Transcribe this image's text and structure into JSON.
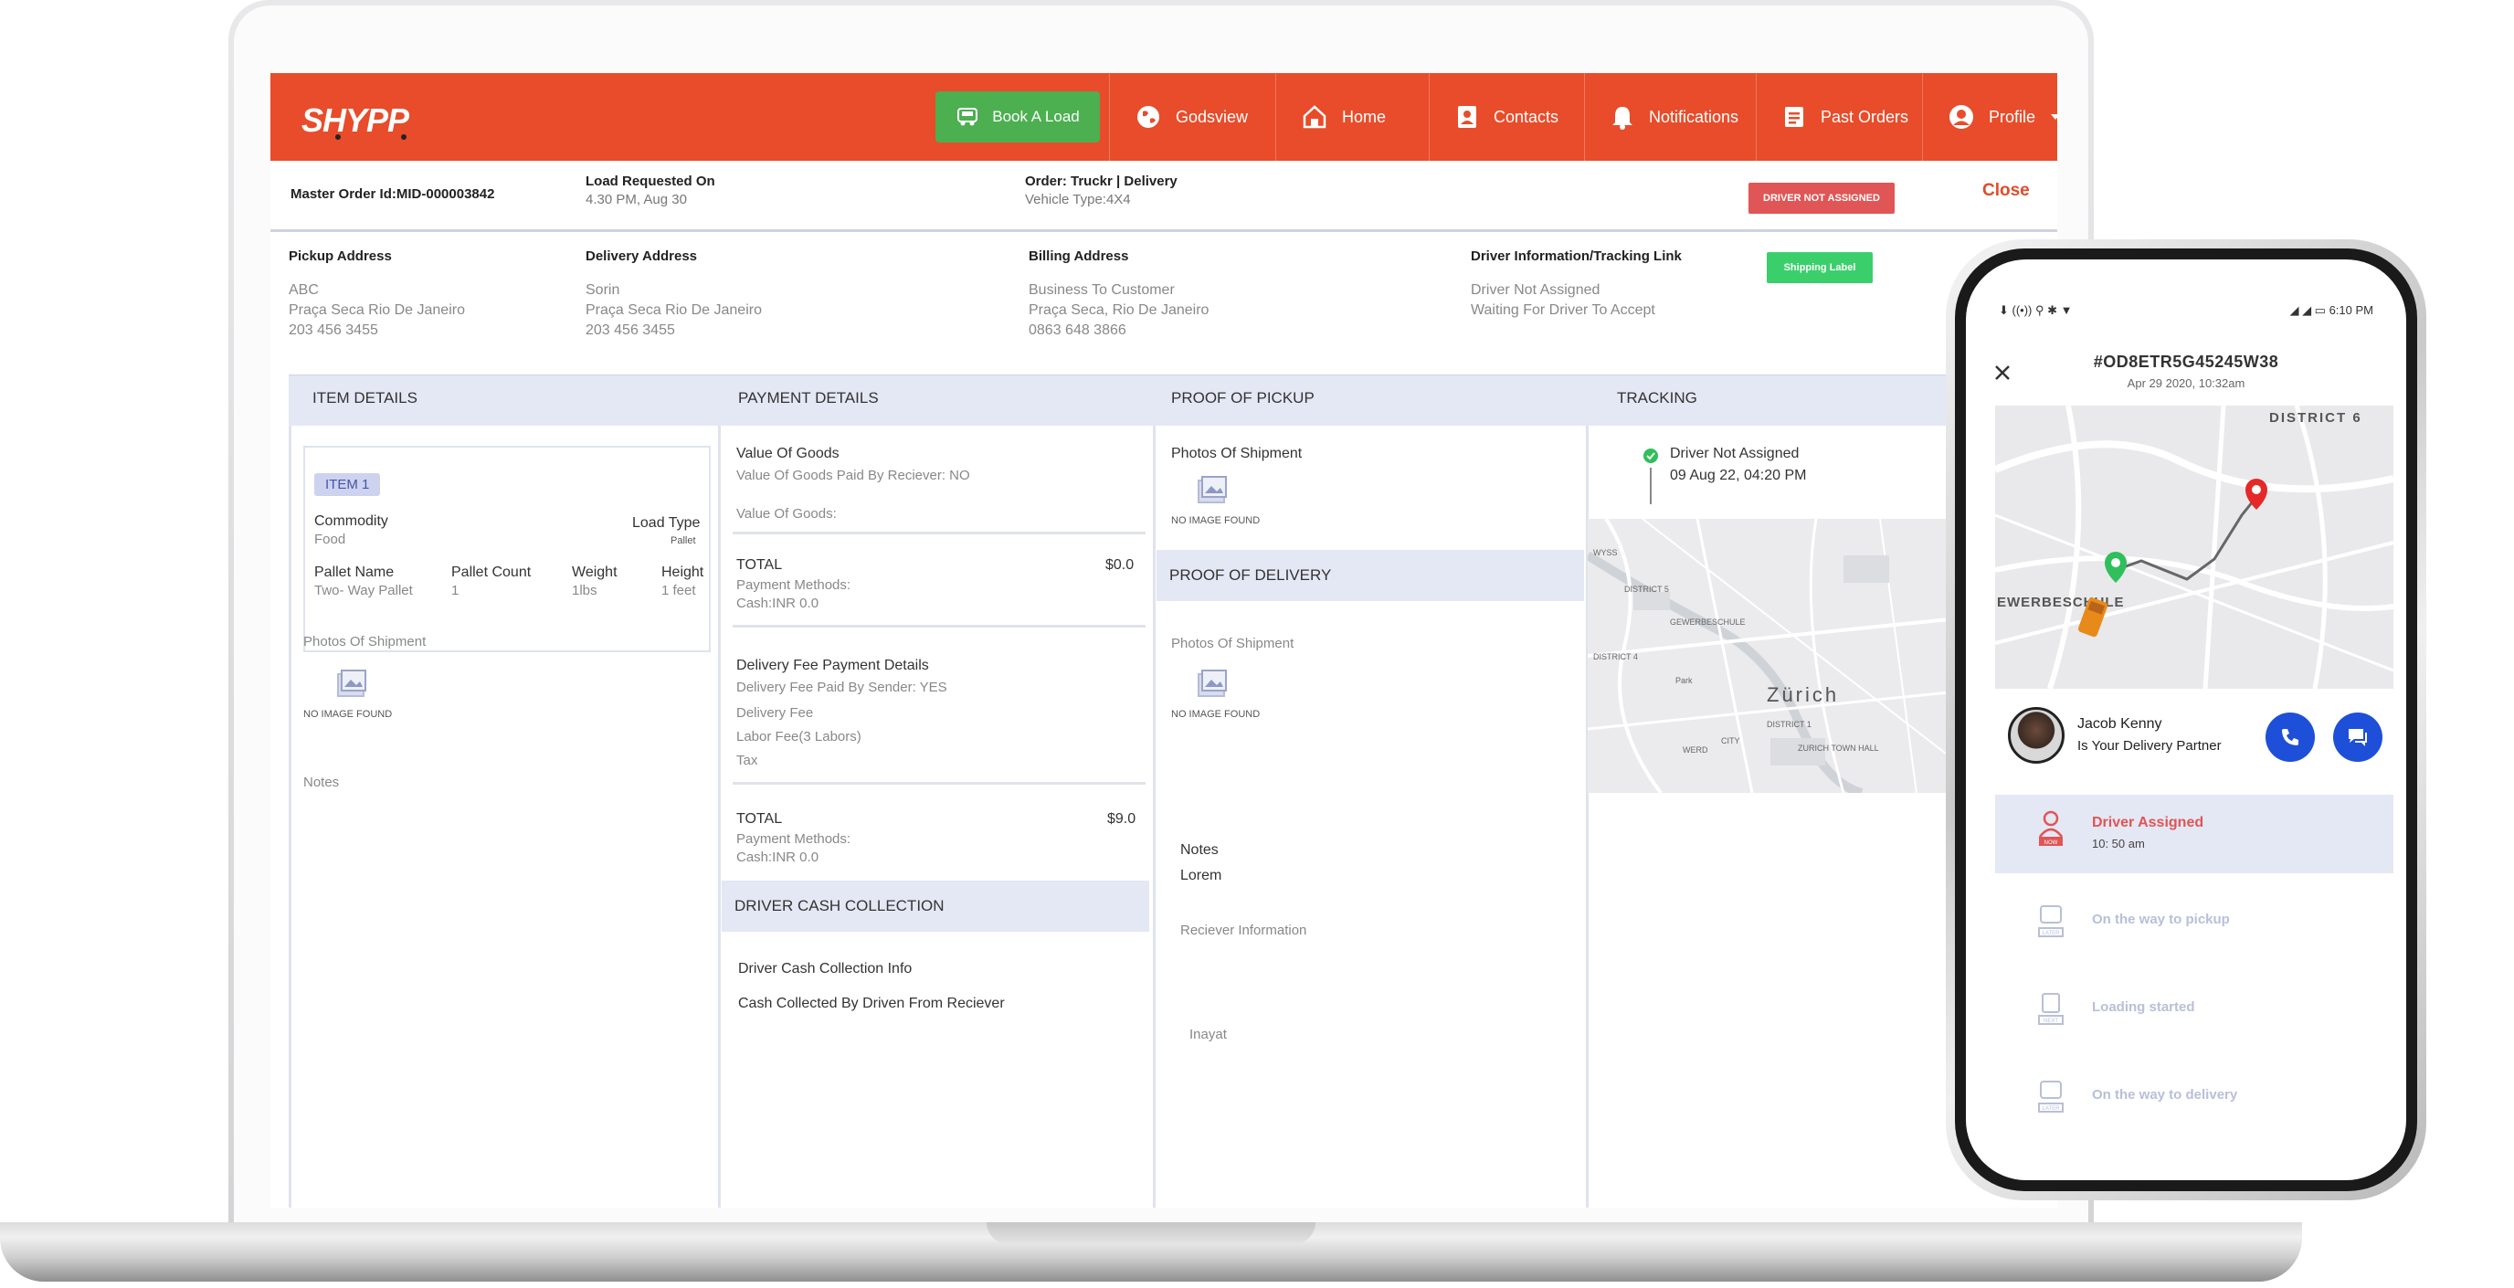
{
  "nav": {
    "logo": "SHYPP",
    "book_label": "Book A Load",
    "items": [
      {
        "label": "Godsview",
        "icon": "globe-icon"
      },
      {
        "label": "Home",
        "icon": "home-icon"
      },
      {
        "label": "Contacts",
        "icon": "contacts-icon"
      },
      {
        "label": "Notifications",
        "icon": "bell-icon"
      },
      {
        "label": "Past Orders",
        "icon": "orders-icon"
      },
      {
        "label": "Profile",
        "icon": "profile-icon"
      }
    ]
  },
  "order": {
    "master_id": "Master Order Id:MID-000003842",
    "load_requested_label": "Load Requested On",
    "load_requested_value": "4.30 PM, Aug 30",
    "order_label": "Order: Truckr | Delivery",
    "vehicle_type": "Vehicle Type:4X4",
    "status_badge": "DRIVER NOT ASSIGNED",
    "close_label": "Close"
  },
  "addresses": {
    "pickup": {
      "heading": "Pickup Address",
      "lines": [
        "ABC",
        "Praça Seca Rio De Janeiro",
        " 203 456 3455"
      ]
    },
    "delivery": {
      "heading": "Delivery Address",
      "lines": [
        "Sorin",
        "Praça Seca Rio De Janeiro",
        " 203 456 3455"
      ]
    },
    "billing": {
      "heading": "Billing Address",
      "lines": [
        "Business To Customer",
        "Praça Seca, Rio De Janeiro",
        "0863 648 3866"
      ]
    },
    "driver": {
      "heading": "Driver Information/Tracking Link",
      "lines": [
        "Driver Not Assigned",
        "Waiting For Driver To Accept"
      ]
    },
    "shipping_label": "Shipping Label"
  },
  "sections": {
    "item_details": "ITEM  DETAILS",
    "payment_details": "PAYMENT DETAILS",
    "proof_of_pickup": "PROOF OF PICKUP",
    "tracking": "TRACKING"
  },
  "item": {
    "tag": "ITEM 1",
    "commodity_label": "Commodity",
    "commodity_value": "Food",
    "load_type_label": "Load Type",
    "load_type_value": "Pallet",
    "pallet_name_label": "Pallet Name",
    "pallet_name_value": "Two- Way Pallet",
    "pallet_count_label": "Pallet Count",
    "pallet_count_value": "1",
    "weight_label": "Weight",
    "weight_value": "1lbs",
    "height_label": "Height",
    "height_value": "1 feet",
    "photos_label": "Photos Of Shipment",
    "no_image": "NO IMAGE FOUND",
    "notes_label": "Notes"
  },
  "payment": {
    "value_of_goods": "Value Of Goods",
    "paid_by_receiver": "Value Of Goods Paid By Reciever: NO",
    "value_of_goods_colon": "Value Of Goods:",
    "total_label": "TOTAL",
    "total_1": "$0.0",
    "payment_methods": "Payment Methods:",
    "cash_inr": "Cash:INR 0.0",
    "delivery_fee_details": "Delivery Fee Payment Details",
    "paid_by_sender": "Delivery Fee Paid By Sender: YES",
    "delivery_fee": "Delivery Fee",
    "labor_fee": "Labor Fee(3 Labors)",
    "tax": "Tax",
    "total_2": "$9.0",
    "driver_cash_collection": "DRIVER CASH COLLECTION",
    "driver_cash_info": "Driver Cash Collection Info",
    "cash_collected": "Cash Collected By Driven From Reciever"
  },
  "proof": {
    "photos_label": "Photos Of Shipment",
    "no_image": "NO IMAGE FOUND",
    "proof_of_delivery": "PROOF OF DELIVERY",
    "notes_label": "Notes",
    "notes_value": "Lorem",
    "receiver_info": "Reciever Information",
    "receiver_name": "Inayat"
  },
  "tracking": {
    "status": "Driver Not Assigned",
    "time": "09 Aug 22, 04:20 PM",
    "map_labels": [
      "WYSS",
      "DISTRICT 5",
      "GEWERBESCHULE",
      "DISTRICT 4",
      "Zürich",
      "DISTRICT 1",
      "CITY",
      "WERD",
      "ZURICH TOWN HALL",
      "Park"
    ]
  },
  "phone": {
    "status_time": "6:10 PM",
    "order_id": "#OD8ETR5G45245W38",
    "order_date": "Apr 29 2020, 10:32am",
    "map_labels": [
      "DISTRICT 6",
      "EWERBESCHULE"
    ],
    "driver_name": "Jacob Kenny",
    "driver_role": "Is Your Delivery Partner",
    "steps": [
      {
        "label": "Driver Assigned",
        "time": "10: 50 am",
        "icon_tag": "NOW"
      },
      {
        "label": "On the way to pickup",
        "icon_tag": "LATER"
      },
      {
        "label": "Loading started",
        "icon_tag": "NEXT"
      },
      {
        "label": "On the way to delivery",
        "icon_tag": "LATER"
      }
    ]
  },
  "colors": {
    "brand": "#e84c2a",
    "green": "#4caf50",
    "badge_red": "#e05555",
    "section_bg": "#e4e8f4",
    "call_blue": "#1e4fd8"
  }
}
